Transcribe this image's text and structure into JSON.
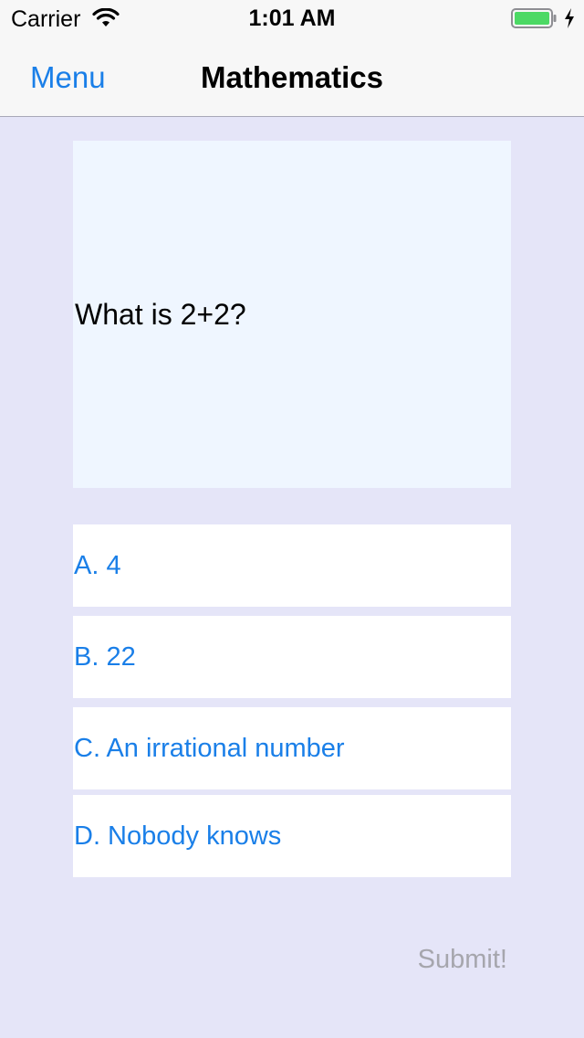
{
  "status_bar": {
    "carrier": "Carrier",
    "time": "1:01 AM",
    "battery_color": "#4cd964"
  },
  "nav": {
    "back_label": "Menu",
    "title": "Mathematics"
  },
  "question": {
    "text": "What is 2+2?"
  },
  "answers": [
    {
      "label": "A. 4"
    },
    {
      "label": "B. 22"
    },
    {
      "label": "C. An irrational number"
    },
    {
      "label": "D. Nobody knows"
    }
  ],
  "submit_label": "Submit!",
  "colors": {
    "accent": "#1a7fe8",
    "background": "#e5e5f8",
    "question_bg": "#eff6ff",
    "disabled_text": "#a6a6ad"
  }
}
